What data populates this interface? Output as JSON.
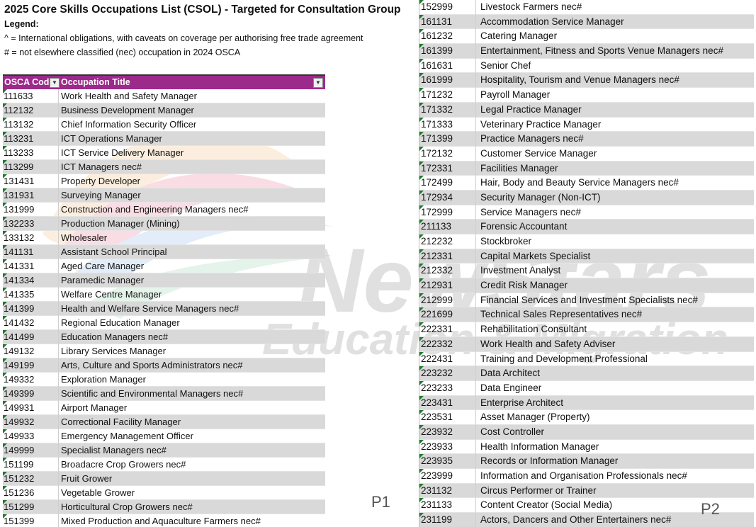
{
  "title": "2025 Core Skills Occupations List (CSOL) - Targeted for Consultation Group",
  "legend": {
    "label": "Legend:",
    "line1": "^ = International obligations, with caveats on coverage per authorising free trade agreement",
    "line2": "# = not elsewhere classified (nec) occupation in 2024 OSCA"
  },
  "table_headers": {
    "code": "OSCA Code",
    "title": "Occupation Title"
  },
  "watermark": {
    "line1": "NewStars",
    "line2": "Education & Migration"
  },
  "page_labels": {
    "p1": "P1",
    "p2": "P2"
  },
  "left_rows": [
    {
      "code": "111633",
      "title": "Work Health and Safety Manager"
    },
    {
      "code": "112132",
      "title": "Business Development Manager"
    },
    {
      "code": "113132",
      "title": "Chief Information Security Officer"
    },
    {
      "code": "113231",
      "title": "ICT Operations Manager"
    },
    {
      "code": "113233",
      "title": "ICT Service Delivery Manager"
    },
    {
      "code": "113299",
      "title": "ICT Managers nec#"
    },
    {
      "code": "131431",
      "title": "Property Developer"
    },
    {
      "code": "131931",
      "title": "Surveying Manager"
    },
    {
      "code": "131999",
      "title": "Construction and Engineering Managers nec#"
    },
    {
      "code": "132233",
      "title": "Production Manager (Mining)"
    },
    {
      "code": "133132",
      "title": "Wholesaler"
    },
    {
      "code": "141131",
      "title": "Assistant School Principal"
    },
    {
      "code": "141331",
      "title": "Aged Care Manager"
    },
    {
      "code": "141334",
      "title": "Paramedic Manager"
    },
    {
      "code": "141335",
      "title": "Welfare Centre Manager"
    },
    {
      "code": "141399",
      "title": "Health and Welfare Service Managers nec#"
    },
    {
      "code": "141432",
      "title": "Regional Education Manager"
    },
    {
      "code": "141499",
      "title": "Education Managers nec#"
    },
    {
      "code": "149132",
      "title": "Library Services Manager"
    },
    {
      "code": "149199",
      "title": "Arts, Culture and Sports Administrators nec#"
    },
    {
      "code": "149332",
      "title": "Exploration Manager"
    },
    {
      "code": "149399",
      "title": "Scientific and Environmental Managers nec#"
    },
    {
      "code": "149931",
      "title": "Airport Manager"
    },
    {
      "code": "149932",
      "title": "Correctional Facility Manager"
    },
    {
      "code": "149933",
      "title": "Emergency Management Officer"
    },
    {
      "code": "149999",
      "title": "Specialist Managers nec#"
    },
    {
      "code": "151199",
      "title": "Broadacre Crop Growers nec#"
    },
    {
      "code": "151232",
      "title": "Fruit Grower"
    },
    {
      "code": "151236",
      "title": "Vegetable Grower"
    },
    {
      "code": "151299",
      "title": "Horticultural Crop Growers nec#"
    },
    {
      "code": "151399",
      "title": "Mixed Production and Aquaculture Farmers nec#"
    }
  ],
  "right_rows": [
    {
      "code": "152999",
      "title": "Livestock Farmers nec#"
    },
    {
      "code": "161131",
      "title": "Accommodation Service Manager"
    },
    {
      "code": "161232",
      "title": "Catering Manager"
    },
    {
      "code": "161399",
      "title": "Entertainment, Fitness and Sports Venue Managers nec#"
    },
    {
      "code": "161631",
      "title": "Senior Chef"
    },
    {
      "code": "161999",
      "title": "Hospitality, Tourism and Venue Managers nec#"
    },
    {
      "code": "171232",
      "title": "Payroll Manager"
    },
    {
      "code": "171332",
      "title": "Legal Practice Manager"
    },
    {
      "code": "171333",
      "title": "Veterinary Practice Manager"
    },
    {
      "code": "171399",
      "title": "Practice Managers nec#"
    },
    {
      "code": "172132",
      "title": "Customer Service Manager"
    },
    {
      "code": "172331",
      "title": "Facilities Manager"
    },
    {
      "code": "172499",
      "title": "Hair, Body and Beauty Service Managers nec#"
    },
    {
      "code": "172934",
      "title": "Security Manager (Non-ICT)"
    },
    {
      "code": "172999",
      "title": "Service Managers nec#"
    },
    {
      "code": "211133",
      "title": "Forensic Accountant"
    },
    {
      "code": "212232",
      "title": "Stockbroker"
    },
    {
      "code": "212331",
      "title": "Capital Markets Specialist"
    },
    {
      "code": "212332",
      "title": "Investment Analyst"
    },
    {
      "code": "212931",
      "title": "Credit Risk Manager"
    },
    {
      "code": "212999",
      "title": "Financial Services and Investment Specialists nec#"
    },
    {
      "code": "221699",
      "title": "Technical Sales Representatives nec#"
    },
    {
      "code": "222331",
      "title": "Rehabilitation Consultant"
    },
    {
      "code": "222332",
      "title": "Work Health and Safety Adviser"
    },
    {
      "code": "222431",
      "title": "Training and Development Professional"
    },
    {
      "code": "223232",
      "title": "Data Architect"
    },
    {
      "code": "223233",
      "title": "Data Engineer"
    },
    {
      "code": "223431",
      "title": "Enterprise Architect"
    },
    {
      "code": "223531",
      "title": "Asset Manager (Property)"
    },
    {
      "code": "223932",
      "title": "Cost Controller"
    },
    {
      "code": "223933",
      "title": "Health Information Manager"
    },
    {
      "code": "223935",
      "title": "Records or Information Manager"
    },
    {
      "code": "223999",
      "title": "Information and Organisation Professionals nec#"
    },
    {
      "code": "231132",
      "title": "Circus Performer or Trainer"
    },
    {
      "code": "231133",
      "title": "Content Creator (Social Media)"
    },
    {
      "code": "231199",
      "title": "Actors, Dancers and Other Entertainers nec#"
    }
  ],
  "colors": {
    "header_bg": "#9b2a8a",
    "alt_row": "#d9d9d9",
    "cell_marker": "#1e7a2e"
  }
}
